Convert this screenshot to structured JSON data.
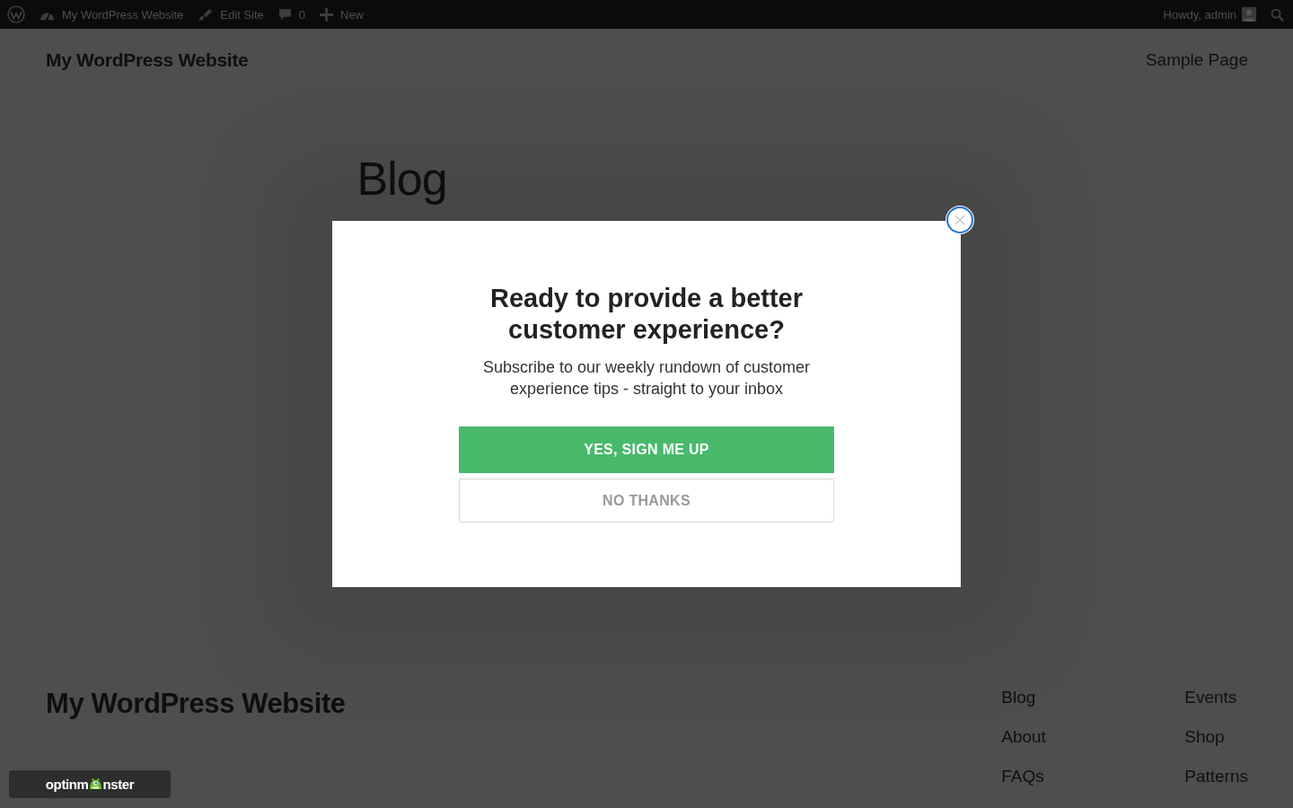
{
  "admin_bar": {
    "items": [
      {
        "kind": "logo"
      },
      {
        "kind": "dashboard",
        "label": "My WordPress Website"
      },
      {
        "kind": "brush",
        "label": "Edit Site"
      },
      {
        "kind": "comments",
        "label": "0"
      },
      {
        "kind": "new",
        "label": "New"
      }
    ],
    "account": {
      "greeting": "Howdy, admin"
    }
  },
  "header": {
    "site_title": "My WordPress Website",
    "nav": [
      "Sample Page"
    ]
  },
  "main": {
    "heading": "Blog"
  },
  "popup": {
    "title": "Ready to provide a better customer experience?",
    "text": "Subscribe to our weekly rundown of customer experience tips - straight to your inbox",
    "buttons": [
      {
        "kind": "primary",
        "label": "YES, SIGN ME UP"
      },
      {
        "kind": "secondary",
        "label": "NO THANKS"
      }
    ]
  },
  "footer": {
    "site_title": "My WordPress Website",
    "nav_columns": [
      [
        "Blog",
        "About",
        "FAQs"
      ],
      [
        "Events",
        "Shop",
        "Patterns"
      ]
    ]
  },
  "badge": {
    "text_start": "optinm",
    "text_end": "nster"
  }
}
